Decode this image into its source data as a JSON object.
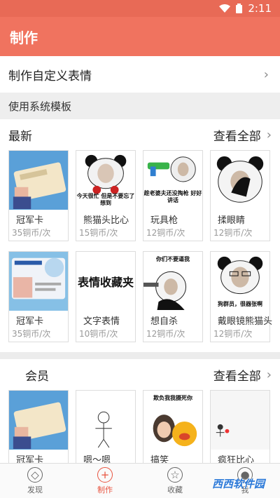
{
  "status_bar": {
    "time": "2:11"
  },
  "app_bar": {
    "title": "制作"
  },
  "custom_row": {
    "label": "制作自定义表情"
  },
  "system_section": {
    "label": "使用系统模板"
  },
  "latest": {
    "title": "最新",
    "see_all": "查看全部",
    "items": [
      {
        "name": "冠军卡",
        "price": "35铜币/次"
      },
      {
        "name": "熊猫头比心",
        "price": "15铜币/次",
        "caption": "今天很忙 但是不要忘了想到"
      },
      {
        "name": "玩具枪",
        "price": "12铜币/次",
        "caption": "趁老婆夫还没掏枪 好好讲话"
      },
      {
        "name": "揉眼睛",
        "price": "12铜币/次"
      },
      {
        "name": "冠军卡",
        "price": "35铜币/次"
      },
      {
        "name": "文字表情",
        "price": "10铜币/次",
        "caption": "表情收藏夹"
      },
      {
        "name": "想自杀",
        "price": "12铜币/次",
        "caption": "你们不要逼我"
      },
      {
        "name": "戴眼镜熊猫头",
        "price": "12铜币/次",
        "caption": "狗群员，很器张啊"
      }
    ]
  },
  "member": {
    "title": "会员",
    "see_all": "查看全部",
    "items": [
      {
        "name": "冠军卡"
      },
      {
        "name": "嗯～嗯"
      },
      {
        "name": "搞笑",
        "caption": "欺负我我摄死你"
      },
      {
        "name": "疯狂比心"
      }
    ]
  },
  "bottom_nav": {
    "discover": "发现",
    "make": "制作",
    "favorites": "收藏",
    "me": "我"
  },
  "watermark": "西西软件园"
}
